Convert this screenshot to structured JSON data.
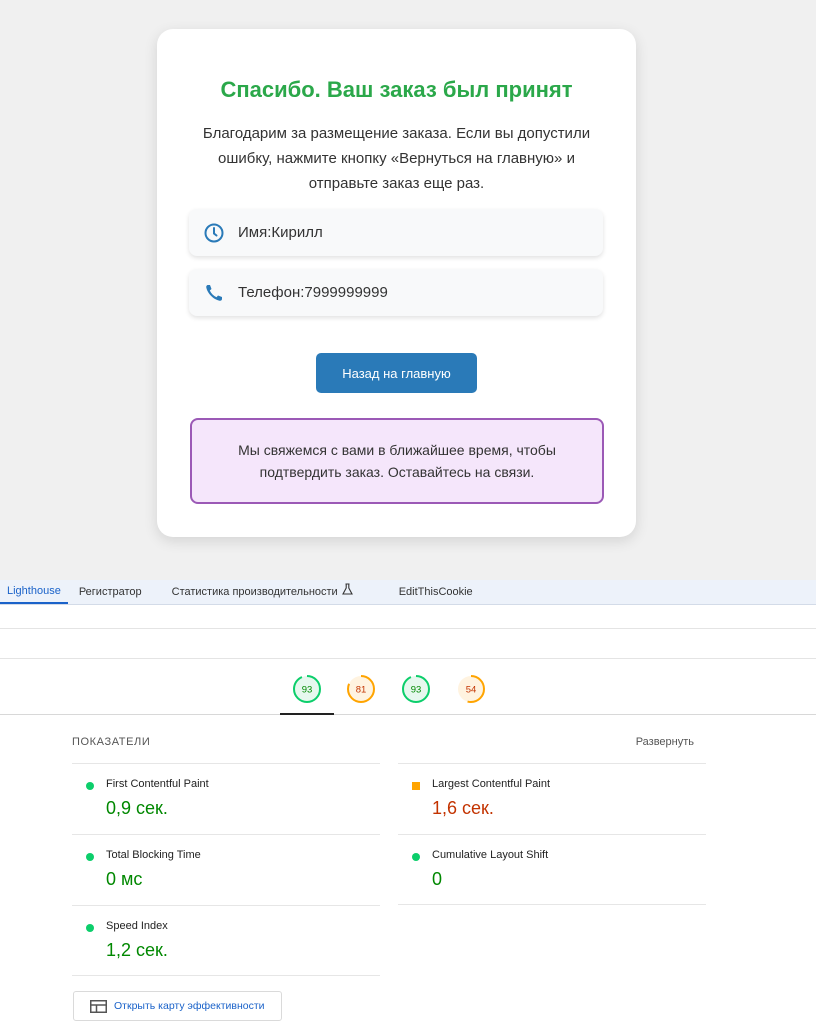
{
  "page": {
    "title": "Спасибо. Ваш заказ был принят",
    "description": "Благодарим за размещение заказа. Если вы допустили ошибку, нажмите кнопку «Вернуться на главную» и отправьте заказ еще раз.",
    "name_row": {
      "text": "Имя:Кирилл",
      "icon": "clock-icon"
    },
    "phone_row": {
      "text": "Телефон:7999999999",
      "icon": "phone-icon"
    },
    "home_button": "Назад на главную",
    "notice": "Мы свяжемся с вами в ближайшее время, чтобы подтвердить заказ. Оставайтесь на связи.",
    "colors": {
      "title": "#2ba84a",
      "button": "#2a7ab8",
      "notice_bg": "#f5e6fb",
      "notice_border": "#9b59b6"
    }
  },
  "devtools": {
    "tabs": [
      {
        "label": "Lighthouse",
        "active": true
      },
      {
        "label": "Регистратор"
      },
      {
        "label": "Статистика производительности",
        "icon": "flask-icon"
      },
      {
        "label": "EditThisCookie"
      }
    ],
    "scores": [
      {
        "value": 93,
        "color": "#0cce6b",
        "fill": "#e6f8ee",
        "text_color": "#008800"
      },
      {
        "value": 81,
        "color": "#ffa400",
        "fill": "#fff3e0",
        "text_color": "#c33300"
      },
      {
        "value": 93,
        "color": "#0cce6b",
        "fill": "#e6f8ee",
        "text_color": "#008800"
      },
      {
        "value": 54,
        "color": "#ffa400",
        "fill": "#fff3e0",
        "text_color": "#c33300"
      }
    ],
    "metrics_label": "ПОКАЗАТЕЛИ",
    "expand_label": "Развернуть",
    "metrics": [
      {
        "name": "First Contentful Paint",
        "value": "0,9 сек.",
        "status": "pass"
      },
      {
        "name": "Largest Contentful Paint",
        "value": "1,6 сек.",
        "status": "average"
      },
      {
        "name": "Total Blocking Time",
        "value": "0 мс",
        "status": "pass"
      },
      {
        "name": "Cumulative Layout Shift",
        "value": "0",
        "status": "pass"
      },
      {
        "name": "Speed Index",
        "value": "1,2 сек.",
        "status": "pass"
      }
    ],
    "status_colors": {
      "pass": "#0cce6b",
      "average": "#ffa400",
      "pass_text": "#008800",
      "average_text": "#c33300"
    },
    "treemap_button": "Открыть карту эффективности"
  }
}
